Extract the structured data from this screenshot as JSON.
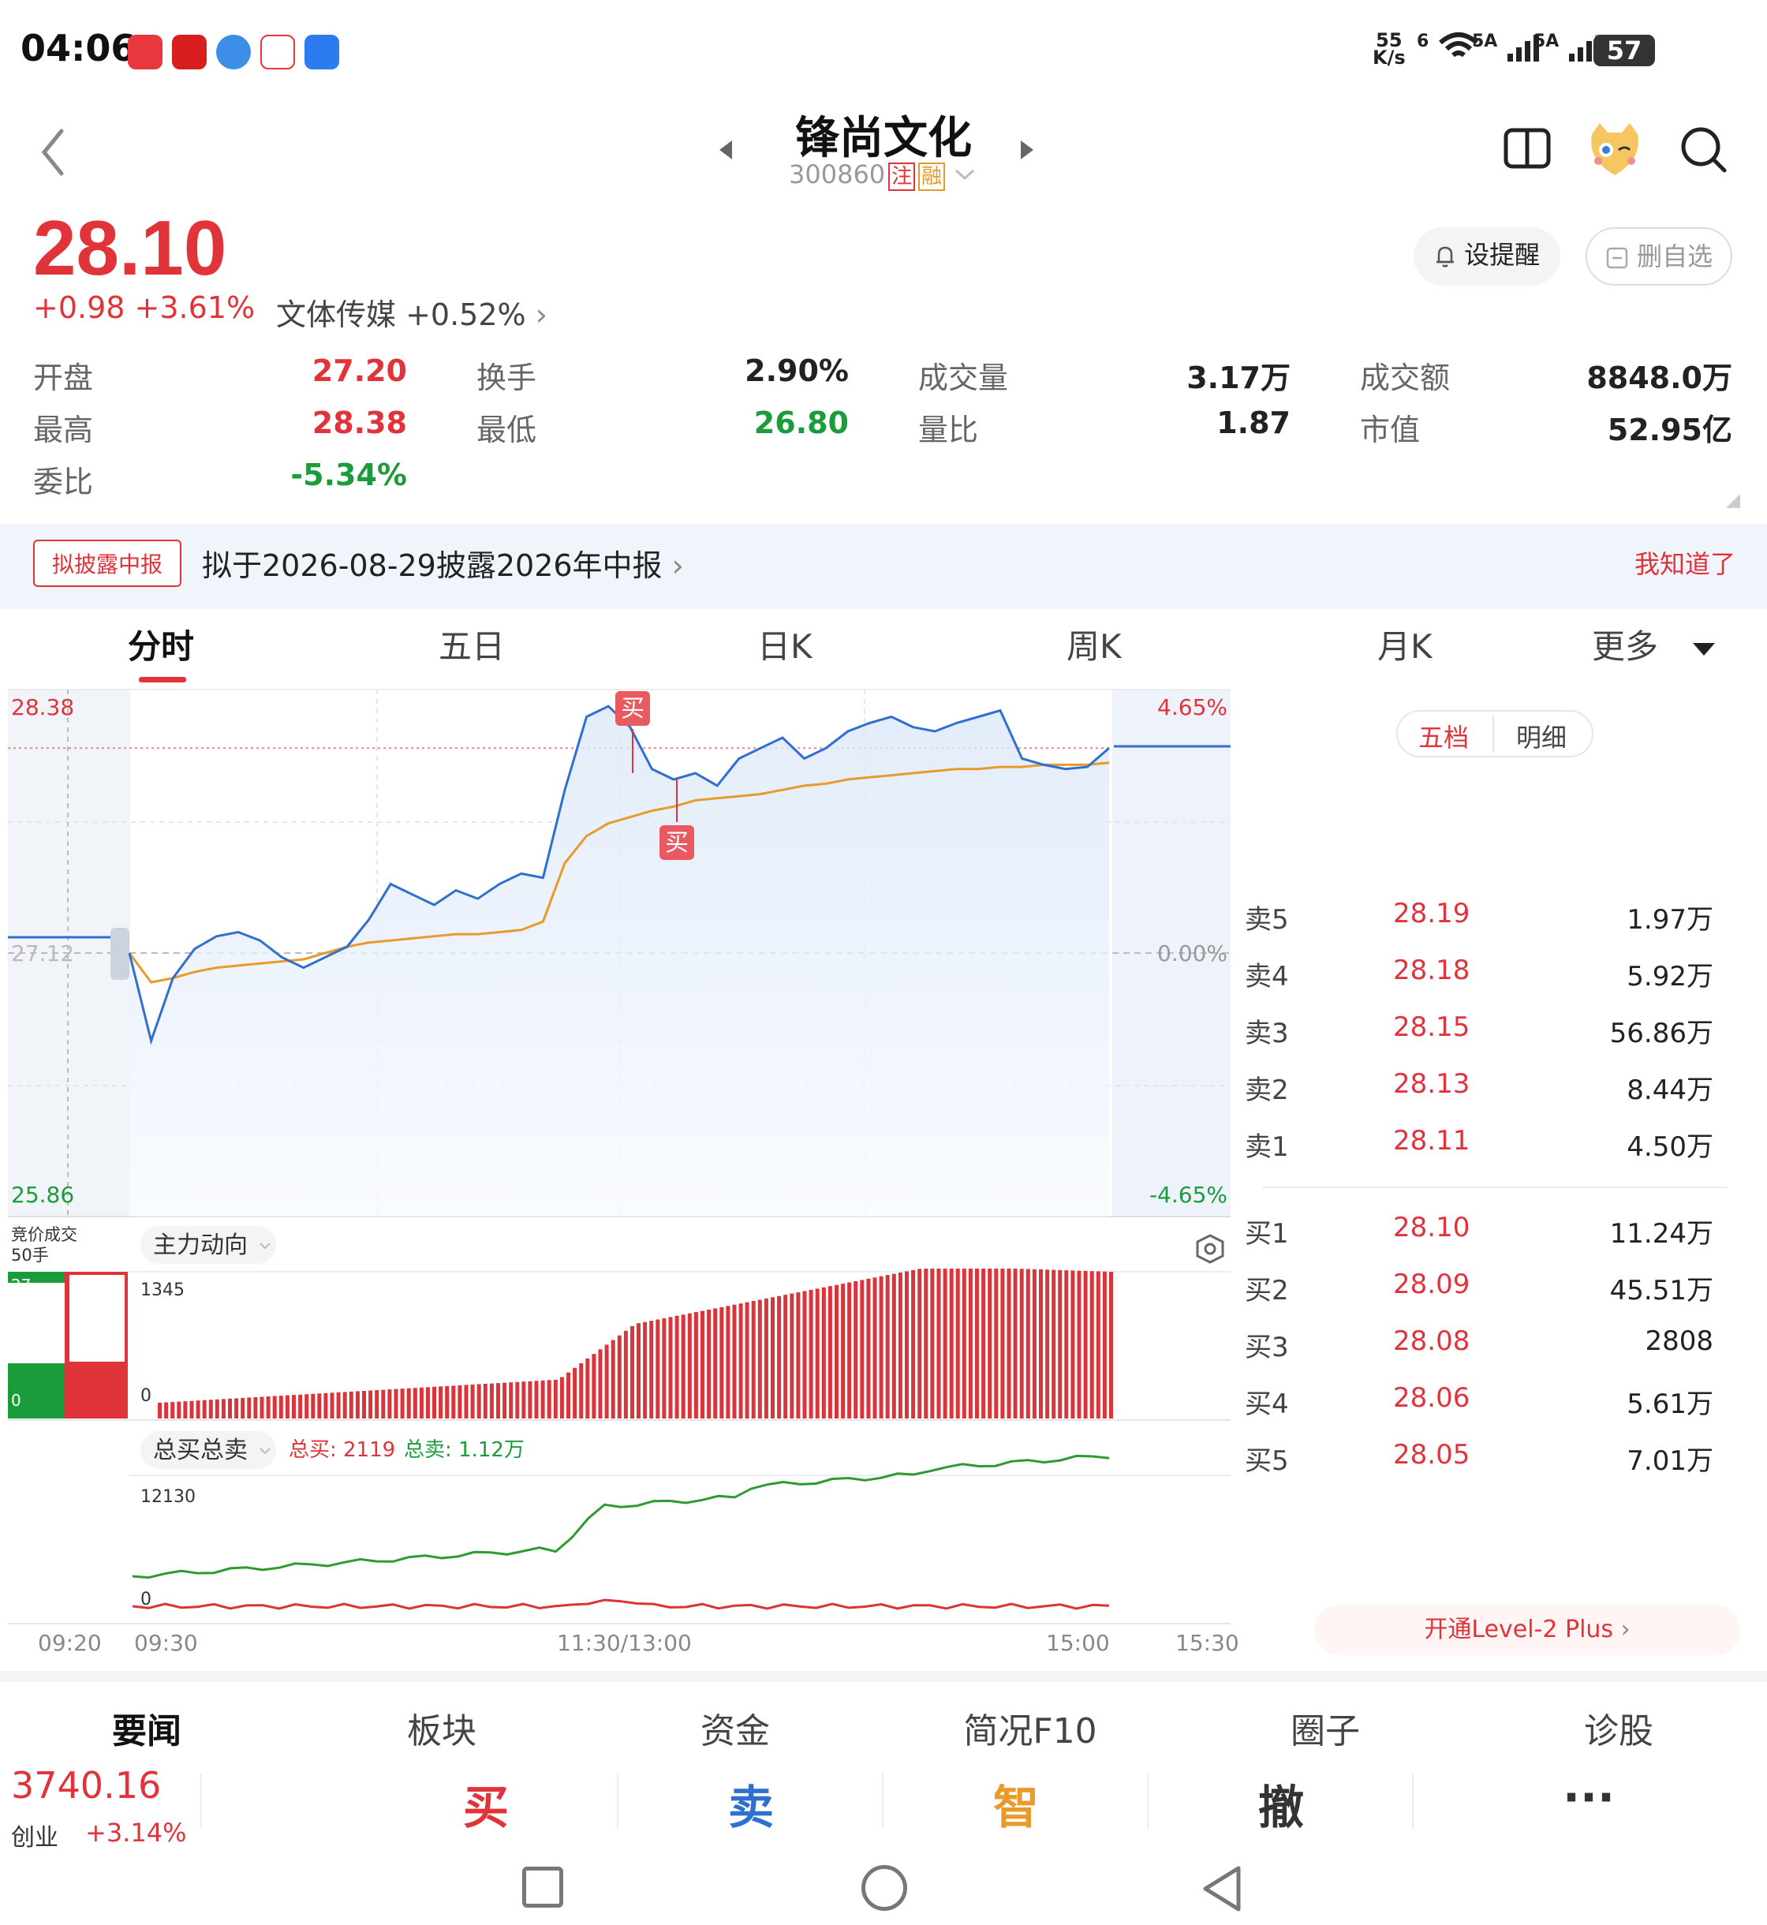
{
  "status_bar": {
    "time": "04:06",
    "net_speed_value": "55",
    "net_speed_unit": "K/s",
    "wifi_label": "6",
    "sig1_label": "5A",
    "sig2_label": "5A",
    "battery": "57"
  },
  "header": {
    "stock_name": "锋尚文化",
    "stock_code": "300860",
    "tag_register": "注",
    "tag_margin": "融"
  },
  "quote": {
    "price": "28.10",
    "change": "+0.98 +3.61%",
    "sector": "文体传媒 +0.52%",
    "alert_label": "设提醒",
    "fav_label": "删自选"
  },
  "stats": [
    {
      "label": "开盘",
      "value": "27.20",
      "color": "#e0333a"
    },
    {
      "label": "换手",
      "value": "2.90%",
      "color": "#222222"
    },
    {
      "label": "成交量",
      "value": "3.17万",
      "color": "#222222"
    },
    {
      "label": "成交额",
      "value": "8848.0万",
      "color": "#222222"
    },
    {
      "label": "最高",
      "value": "28.38",
      "color": "#e0333a"
    },
    {
      "label": "最低",
      "value": "26.80",
      "color": "#1a9c3a"
    },
    {
      "label": "量比",
      "value": "1.87",
      "color": "#222222"
    },
    {
      "label": "市值",
      "value": "52.95亿",
      "color": "#222222"
    },
    {
      "label": "委比",
      "value": "-5.34%",
      "color": "#1a9c3a"
    }
  ],
  "notice": {
    "tag": "拟披露中报",
    "text": "拟于2026-08-29披露2026年中报",
    "dismiss": "我知道了"
  },
  "tabs": [
    "分时",
    "五日",
    "日K",
    "周K",
    "月K",
    "更多"
  ],
  "chart": {
    "price_high": "28.38",
    "price_low": "25.86",
    "prev_close_label": "27.12",
    "pct_high": "4.65%",
    "pct_zero": "0.00%",
    "pct_low": "-4.65%",
    "buy_marker": "买",
    "auction_label_1": "竞价成交",
    "auction_label_2": "50手",
    "auction_top": "27",
    "auction_bottom": "0",
    "main_force_label": "主力动向",
    "main_force_max": "1345",
    "main_force_min": "0",
    "total_label": "总买总卖",
    "total_buy": "总买: 2119",
    "total_sell": "总卖: 1.12万",
    "total_max": "12130",
    "total_min": "0",
    "time_labels": [
      "09:20",
      "09:30",
      "11:30/13:00",
      "15:00",
      "15:30"
    ]
  },
  "chart_data": {
    "type": "line",
    "title": "",
    "series": [
      {
        "color": "#2f6fd0",
        "values": [
          27.12,
          26.7,
          27.0,
          27.14,
          27.2,
          27.22,
          27.18,
          27.1,
          27.05,
          27.1,
          27.15,
          27.28,
          27.45,
          27.4,
          27.35,
          27.42,
          27.38,
          27.45,
          27.5,
          27.48,
          27.9,
          28.25,
          28.3,
          28.2,
          28.0,
          27.95,
          27.98,
          27.92,
          28.05,
          28.1,
          28.15,
          28.05,
          28.1,
          28.18,
          28.22,
          28.25,
          28.2,
          28.18,
          28.22,
          28.25,
          28.28,
          28.05,
          28.02,
          28.0,
          28.01,
          28.1
        ]
      },
      {
        "color": "#e89a2a",
        "values": [
          27.12,
          26.98,
          27.0,
          27.03,
          27.05,
          27.06,
          27.07,
          27.08,
          27.09,
          27.12,
          27.15,
          27.17,
          27.18,
          27.19,
          27.2,
          27.21,
          27.21,
          27.22,
          27.23,
          27.27,
          27.55,
          27.68,
          27.74,
          27.77,
          27.8,
          27.82,
          27.85,
          27.86,
          27.87,
          27.88,
          27.9,
          27.92,
          27.93,
          27.95,
          27.96,
          27.97,
          27.98,
          27.99,
          28.0,
          28.0,
          28.01,
          28.01,
          28.02,
          28.02,
          28.02,
          28.03
        ]
      }
    ],
    "ylim": [
      25.86,
      28.38
    ],
    "prev_close": 27.12
  },
  "orderbook": {
    "toggle": [
      "五档",
      "明细"
    ],
    "asks": [
      {
        "label": "卖5",
        "price": "28.19",
        "vol": "1.97万"
      },
      {
        "label": "卖4",
        "price": "28.18",
        "vol": "5.92万"
      },
      {
        "label": "卖3",
        "price": "28.15",
        "vol": "56.86万"
      },
      {
        "label": "卖2",
        "price": "28.13",
        "vol": "8.44万"
      },
      {
        "label": "卖1",
        "price": "28.11",
        "vol": "4.50万"
      }
    ],
    "bids": [
      {
        "label": "买1",
        "price": "28.10",
        "vol": "11.24万"
      },
      {
        "label": "买2",
        "price": "28.09",
        "vol": "45.51万"
      },
      {
        "label": "买3",
        "price": "28.08",
        "vol": "2808"
      },
      {
        "label": "买4",
        "price": "28.06",
        "vol": "5.61万"
      },
      {
        "label": "买5",
        "price": "28.05",
        "vol": "7.01万"
      }
    ],
    "level2": "开通Level-2 Plus"
  },
  "bottom_tabs": [
    "要闻",
    "板块",
    "资金",
    "简况F10",
    "圈子",
    "诊股"
  ],
  "index": {
    "value": "3740.16",
    "name": "创业",
    "change": "+3.14%"
  },
  "actions": [
    {
      "label": "买",
      "color": "#e0333a"
    },
    {
      "label": "卖",
      "color": "#2f6fd0"
    },
    {
      "label": "智",
      "color": "#e89a2a"
    },
    {
      "label": "撤",
      "color": "#333333"
    },
    {
      "label": "···",
      "color": "#333333"
    }
  ]
}
